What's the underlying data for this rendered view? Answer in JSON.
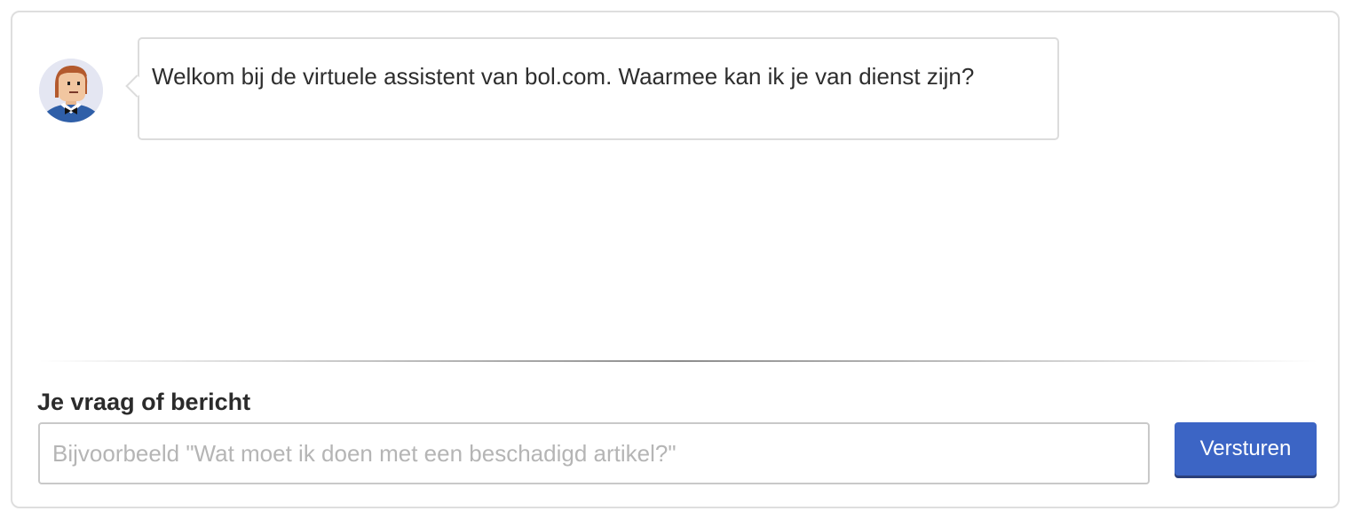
{
  "assistant": {
    "avatar_icon": "assistant-avatar-icon",
    "message": "Welkom bij de virtuele assistent van bol.com. Waarmee kan ik je van dienst zijn?"
  },
  "composer": {
    "label": "Je vraag of bericht",
    "input_value": "",
    "placeholder": "Bijvoorbeeld \"Wat moet ik doen met een beschadigd artikel?\"",
    "send_label": "Versturen"
  },
  "colors": {
    "accent": "#3c65c5",
    "border": "#dedede",
    "placeholder": "#b5b5b5"
  }
}
